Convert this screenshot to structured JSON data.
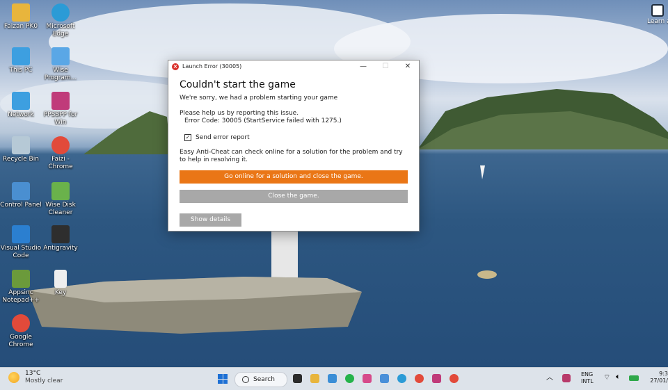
{
  "desktop": {
    "icons": [
      {
        "label": "Faizan PK0",
        "icon": "folder-icon",
        "color": "#e8b53c"
      },
      {
        "label": "Microsoft Edge",
        "icon": "edge-icon",
        "color": "#2b9bd6"
      },
      {
        "label": "This PC",
        "icon": "monitor-icon",
        "color": "#3d9fe0"
      },
      {
        "label": "Wise Program...",
        "icon": "wise-program-icon",
        "color": "#5aa7e6"
      },
      {
        "label": "Network",
        "icon": "network-icon",
        "color": "#3d9fe0"
      },
      {
        "label": "PPSSPP for Win",
        "icon": "ppsspp-icon",
        "color": "#c03b7a"
      },
      {
        "label": "Recycle Bin",
        "icon": "recycle-bin-icon",
        "color": "#b6c9d6"
      },
      {
        "label": "Faizi - Chrome",
        "icon": "chrome-icon",
        "color": "#e24a3a"
      },
      {
        "label": "Control Panel",
        "icon": "control-panel-icon",
        "color": "#4a8fd1"
      },
      {
        "label": "Wise Disk Cleaner",
        "icon": "wise-disk-cleaner-icon",
        "color": "#6ab24b"
      },
      {
        "label": "Visual Studio Code",
        "icon": "vscode-icon",
        "color": "#2b7fd0"
      },
      {
        "label": "Antigravity",
        "icon": "antigravity-icon",
        "color": "#2e2e2e"
      },
      {
        "label": "Appsinc Notepad++",
        "icon": "notepad-icon",
        "color": "#6b9a3b"
      },
      {
        "label": "Key",
        "icon": "file-icon",
        "color": "#eeeeee"
      },
      {
        "label": "Google Chrome",
        "icon": "chrome-icon",
        "color": "#e24a3a"
      }
    ],
    "right_edge_label": "Learn about this picture"
  },
  "dialog": {
    "title": "Launch Error (30005)",
    "minimize_glyph": "—",
    "maximize_glyph": "☐",
    "close_glyph": "✕",
    "heading": "Couldn't start the game",
    "subtitle": "We're sorry, we had a problem starting your game",
    "report_prompt": "Please help us by reporting this issue.",
    "error_code": "Error Code: 30005 (StartService failed with 1275.)",
    "checkbox_label": "Send error report",
    "checkbox_checked": true,
    "info_text": "Easy Anti-Cheat can check online for a solution for the problem and try to help in resolving it.",
    "primary_button": "Go online for a solution and close the game.",
    "secondary_button": "Close the game.",
    "details_button": "Show details",
    "accent_color": "#ea7616"
  },
  "taskbar": {
    "weather_temp": "13°C",
    "weather_desc": "Mostly clear",
    "search_label": "Search",
    "language_top": "ENG",
    "language_bottom": "INTL",
    "time": "9:3",
    "date": "27/01/"
  }
}
